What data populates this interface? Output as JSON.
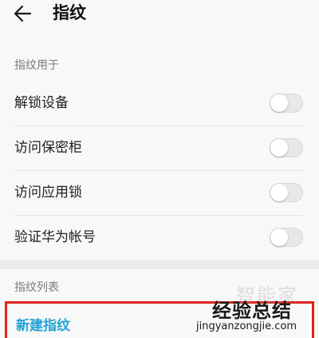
{
  "header": {
    "back_icon": "arrow-left-icon",
    "title": "指纹"
  },
  "section_usage": {
    "label": "指纹用于",
    "items": [
      {
        "label": "解锁设备",
        "enabled": false
      },
      {
        "label": "访问保密柜",
        "enabled": false
      },
      {
        "label": "访问应用锁",
        "enabled": false
      },
      {
        "label": "验证华为帐号",
        "enabled": false
      }
    ]
  },
  "section_list": {
    "label": "指纹列表",
    "new_label": "新建指纹",
    "accent_color": "#1fa3d8",
    "highlight_color": "#e0241f"
  },
  "watermark": {
    "faint_text": "智能家",
    "cn_text": "经验总结",
    "url": "jingyanzongjie.com"
  }
}
